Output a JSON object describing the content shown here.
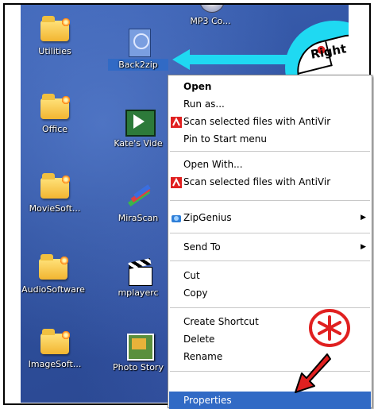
{
  "desktop_icons": [
    {
      "label": "Utilities",
      "glyph": "folder-icon"
    },
    {
      "label": "Office",
      "glyph": "folder-icon"
    },
    {
      "label": "MovieSoft...",
      "glyph": "folder-icon"
    },
    {
      "label": "AudioSoftware",
      "glyph": "folder-icon"
    },
    {
      "label": "ImageSoft...",
      "glyph": "folder-icon"
    },
    {
      "label": "MP3 Co...",
      "glyph": "cd-icon"
    },
    {
      "label": "Back2zip",
      "glyph": "zip-file-icon",
      "selected": true
    },
    {
      "label": "Kate's Vide",
      "glyph": "video-icon"
    },
    {
      "label": "MiraScan",
      "glyph": "scanner-icon"
    },
    {
      "label": "mplayerc",
      "glyph": "clapper-icon"
    },
    {
      "label": "Photo Story",
      "glyph": "photo-icon"
    }
  ],
  "menu": {
    "items": [
      {
        "label": "Open",
        "bold": true
      },
      {
        "label": "Run as..."
      },
      {
        "label": "Scan selected files with AntiVir",
        "icon": "antivir-icon"
      },
      {
        "label": "Pin to Start menu"
      },
      {
        "label": "Open With..."
      },
      {
        "label": "Scan selected files with AntiVir",
        "icon": "antivir-icon"
      },
      {
        "label": "ZipGenius",
        "icon": "zipgenius-icon",
        "submenu": true
      },
      {
        "label": "Send To",
        "submenu": true
      },
      {
        "label": "Cut"
      },
      {
        "label": "Copy"
      },
      {
        "label": "Create Shortcut"
      },
      {
        "label": "Delete"
      },
      {
        "label": "Rename"
      },
      {
        "label": "Properties",
        "highlighted": true
      }
    ],
    "submenu_arrow": "▶"
  },
  "callout": {
    "mouse_label": "Right"
  },
  "colors": {
    "callout": "#1fd9f2",
    "highlight": "#316ac5",
    "antivir_red": "#e02020",
    "arrow_red": "#e02020"
  }
}
